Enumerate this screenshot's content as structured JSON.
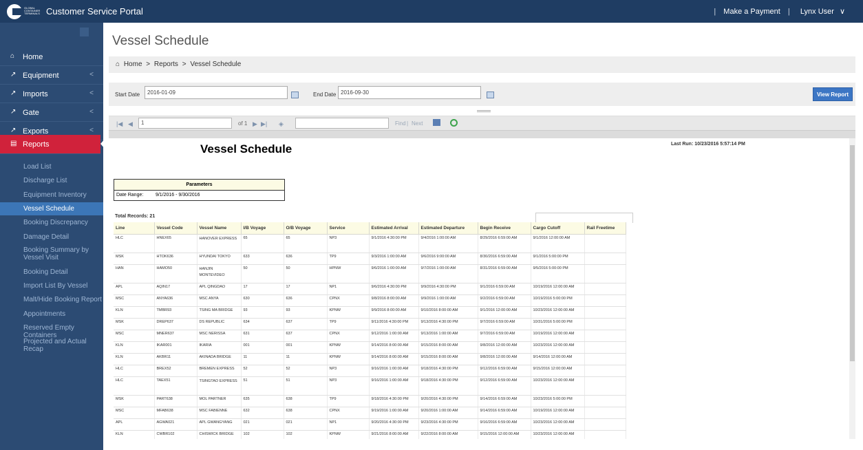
{
  "header": {
    "logo_text": "GLOBAL CONTAINER TERMINALS",
    "app_title": "Customer Service Portal",
    "make_payment": "Make a Payment",
    "user": "Lynx User",
    "separator": "|",
    "user_caret": "∨"
  },
  "sidebar": {
    "items": [
      {
        "label": "Home",
        "icon": "home-icon",
        "glyph": "⌂",
        "has_chevron": false
      },
      {
        "label": "Equipment",
        "icon": "external-link-icon",
        "glyph": "↗",
        "has_chevron": true
      },
      {
        "label": "Imports",
        "icon": "external-link-icon",
        "glyph": "↗",
        "has_chevron": true
      },
      {
        "label": "Gate",
        "icon": "external-link-icon",
        "glyph": "↗",
        "has_chevron": true
      },
      {
        "label": "Exports",
        "icon": "external-link-icon",
        "glyph": "↗",
        "has_chevron": true
      },
      {
        "label": "Reports",
        "icon": "chart-icon",
        "glyph": "▤",
        "has_chevron": false,
        "active": true
      }
    ],
    "chevron": "<",
    "sub_items": [
      "Load List",
      "Discharge List",
      "Equipment Inventory",
      "Vessel Schedule",
      "Booking Discrepancy",
      "Damage Detail",
      "Booking Summary by Vessel Visit",
      "Booking Detail",
      "Import List By Vessel",
      "Malt/Hide Booking Report",
      "Appointments",
      "Reserved Empty Containers",
      "Projected and Actual Recap"
    ],
    "active_sub": "Vessel Schedule"
  },
  "page": {
    "title": "Vessel Schedule",
    "breadcrumb": [
      "Home",
      "Reports",
      "Vessel Schedule"
    ],
    "breadcrumb_home_icon": "⌂",
    "breadcrumb_sep": ">"
  },
  "params_bar": {
    "start_label": "Start Date",
    "start_value": "2016-01-09",
    "end_label": "End Date",
    "end_value": "2016-09-30",
    "view_button": "View Report"
  },
  "toolbar": {
    "page_value": "1",
    "of_text": "of 1",
    "find_link": "Find",
    "next_link": "Next",
    "separator": "|"
  },
  "report": {
    "title": "Vessel Schedule",
    "last_run": "Last Run: 10/23/2016 5:57:14 PM",
    "parameters_header": "Parameters",
    "date_range_label": "Date Range:",
    "date_range_value": "9/1/2016 - 9/30/2016",
    "total_records": "Total Records: 21",
    "columns": [
      "Line",
      "Vessel Code",
      "Vessel Name",
      "I/B Voyage",
      "O/B Voyage",
      "Service",
      "Estimated Arrival",
      "Estimated Departure",
      "Begin Receive",
      "Cargo Cutoff",
      "Rail Freetime"
    ],
    "rows": [
      [
        "HLC",
        "HNEX65",
        "HANOVER EXPRESS",
        "65",
        "65",
        "NP3",
        "9/1/2016 4:30:00 PM",
        "9/4/2016 1:00:00 AM",
        "8/29/2016 6:59:00 AM",
        "9/1/2016 12:00:00 AM",
        ""
      ],
      [
        "MSK",
        "HTOK636",
        "HYUNDAI TOKYO",
        "633",
        "636",
        "TP9",
        "9/3/2016 1:00:00 AM",
        "9/6/2016 9:00:00 AM",
        "8/30/2016 6:59:00 AM",
        "9/1/2016 5:00:00 PM",
        ""
      ],
      [
        "HAN",
        "HAMO50",
        "HANJIN MONTEVIDEO",
        "50",
        "50",
        "HPNW",
        "9/6/2016 1:00:00 AM",
        "9/7/2016 1:00:00 AM",
        "8/31/2016 6:59:00 AM",
        "9/5/2016 5:00:00 PM",
        ""
      ],
      [
        "APL",
        "AQIN17",
        "APL QINGDAO",
        "17",
        "17",
        "NP1",
        "9/6/2016 4:30:00 PM",
        "9/9/2016 4:30:00 PM",
        "9/1/2016 6:59:00 AM",
        "10/19/2016 12:00:00 AM",
        ""
      ],
      [
        "MSC",
        "ANYA636",
        "MSC ANYA",
        "630",
        "636",
        "CPNX",
        "9/8/2016 8:00:00 AM",
        "9/9/2016 1:00:00 AM",
        "9/2/2016 6:59:00 AM",
        "10/19/2016 5:00:00 PM",
        ""
      ],
      [
        "KLN",
        "TMBR93",
        "TSING MA BRIDGE",
        "93",
        "93",
        "KPNW",
        "9/9/2016 8:00:00 AM",
        "9/10/2016 8:00:00 AM",
        "9/1/2016 12:00:00 AM",
        "10/23/2016 12:00:00 AM",
        ""
      ],
      [
        "MSK",
        "DREP637",
        "DS REPUBLIC",
        "634",
        "637",
        "TP9",
        "9/11/2016 4:30:00 PM",
        "9/13/2016 4:30:00 PM",
        "9/7/2016 6:59:00 AM",
        "10/31/2016 5:00:00 PM",
        ""
      ],
      [
        "MSC",
        "MNER637",
        "MSC NERISSA",
        "631",
        "637",
        "CPNX",
        "9/12/2016 1:00:00 AM",
        "9/13/2016 1:00:00 AM",
        "9/7/2016 6:59:00 AM",
        "10/19/2016 12:00:00 AM",
        ""
      ],
      [
        "KLN",
        "IKAR001",
        "IKARIA",
        "001",
        "001",
        "KPNW",
        "9/14/2016 8:00:00 AM",
        "9/15/2016 8:00:00 AM",
        "9/8/2016 12:00:00 AM",
        "10/23/2016 12:00:00 AM",
        ""
      ],
      [
        "KLN",
        "AKBR11",
        "AKINADA BRIDGE",
        "11",
        "11",
        "KPNW",
        "9/14/2016 8:00:00 AM",
        "9/15/2016 8:00:00 AM",
        "9/8/2016 12:00:00 AM",
        "9/14/2016 12:00:00 AM",
        ""
      ],
      [
        "HLC",
        "BREX52",
        "BREMEN EXPRESS",
        "52",
        "52",
        "NP3",
        "9/16/2016 1:00:00 AM",
        "9/18/2016 4:30:00 PM",
        "9/12/2016 6:59:00 AM",
        "9/15/2016 12:00:00 AM",
        ""
      ],
      [
        "HLC",
        "TAEX51",
        "TSINGTAO EXPRESS",
        "51",
        "51",
        "NP3",
        "9/16/2016 1:00:00 AM",
        "9/18/2016 4:30:00 PM",
        "9/12/2016 6:59:00 AM",
        "10/23/2016 12:00:00 AM",
        ""
      ],
      [
        "MSK",
        "PART638",
        "MOL PARTNER",
        "635",
        "638",
        "TP9",
        "9/18/2016 4:30:00 PM",
        "9/20/2016 4:30:00 PM",
        "9/14/2016 6:59:00 AM",
        "10/23/2016 5:00:00 PM",
        ""
      ],
      [
        "MSC",
        "MFAB638",
        "MSC FABIENNE",
        "632",
        "638",
        "CPNX",
        "9/19/2016 1:00:00 AM",
        "9/20/2016 1:00:00 AM",
        "9/14/2016 6:59:00 AM",
        "10/19/2016 12:00:00 AM",
        ""
      ],
      [
        "APL",
        "AGWA021",
        "APL GWANGYANG",
        "021",
        "021",
        "NP1",
        "9/20/2016 4:30:00 PM",
        "9/23/2016 4:30:00 PM",
        "9/16/2016 6:59:00 AM",
        "10/23/2016 12:00:00 AM",
        ""
      ],
      [
        "KLN",
        "CWBR102",
        "CHISWICK BRIDGE",
        "102",
        "102",
        "KPNW",
        "9/21/2016 8:00:00 AM",
        "9/22/2016 8:00:00 AM",
        "9/15/2016 12:00:00 AM",
        "10/23/2016 12:00:00 AM",
        ""
      ]
    ]
  }
}
